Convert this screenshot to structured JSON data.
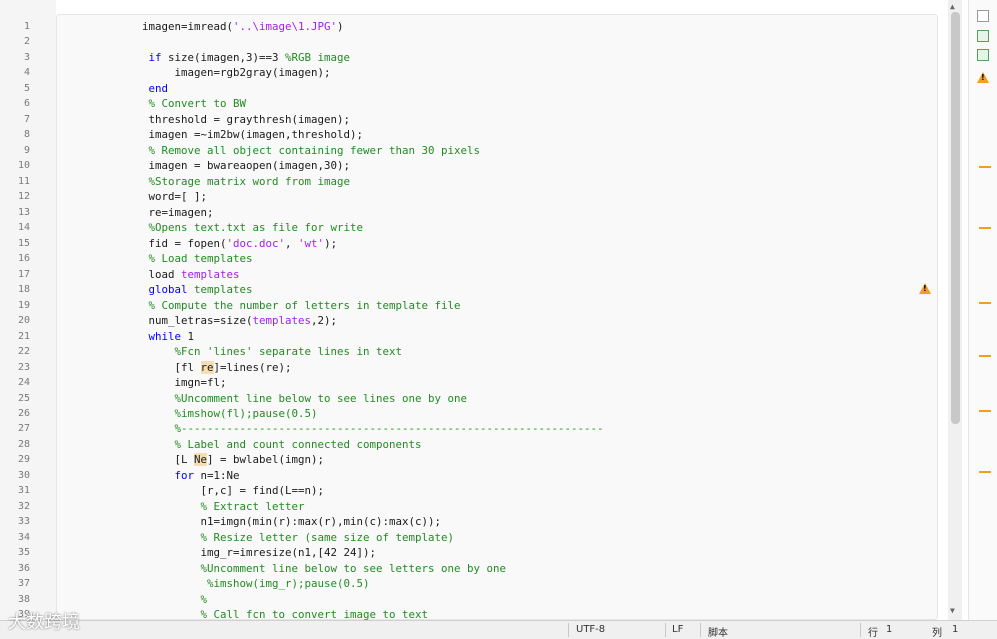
{
  "gutter": {
    "line_numbers": [
      "1",
      "2",
      "3",
      "4",
      "5",
      "6",
      "7",
      "8",
      "9",
      "10",
      "11",
      "12",
      "13",
      "14",
      "15",
      "16",
      "17",
      "18",
      "19",
      "20",
      "21",
      "22",
      "23",
      "24",
      "25",
      "26",
      "27",
      "28",
      "29",
      "30",
      "31",
      "32",
      "33",
      "34",
      "35",
      "36",
      "37",
      "38",
      "39"
    ]
  },
  "code_lines": [
    {
      "indent": 14,
      "parts": [
        {
          "t": "imagen=imread("
        },
        {
          "t": "'..\\image\\1.JPG'",
          "c": "st"
        },
        {
          "t": ")"
        }
      ]
    },
    {
      "indent": 14,
      "parts": []
    },
    {
      "indent": 15,
      "parts": [
        {
          "t": "if",
          "c": "kw"
        },
        {
          "t": " size(imagen,3)==3 "
        },
        {
          "t": "%RGB image",
          "c": "cm"
        }
      ]
    },
    {
      "indent": 19,
      "parts": [
        {
          "t": "imagen=rgb2gray(imagen);"
        }
      ]
    },
    {
      "indent": 15,
      "parts": [
        {
          "t": "end",
          "c": "kw"
        }
      ]
    },
    {
      "indent": 15,
      "parts": [
        {
          "t": "% Convert to BW",
          "c": "cm"
        }
      ]
    },
    {
      "indent": 15,
      "parts": [
        {
          "t": "threshold = graythresh(imagen);"
        }
      ]
    },
    {
      "indent": 15,
      "parts": [
        {
          "t": "imagen =~im2bw(imagen,threshold);"
        }
      ]
    },
    {
      "indent": 15,
      "parts": [
        {
          "t": "% Remove all object containing fewer than 30 pixels",
          "c": "cm"
        }
      ]
    },
    {
      "indent": 15,
      "parts": [
        {
          "t": "imagen = bwareaopen(imagen,30);"
        }
      ]
    },
    {
      "indent": 15,
      "parts": [
        {
          "t": "%Storage matrix word from image",
          "c": "cm"
        }
      ]
    },
    {
      "indent": 15,
      "parts": [
        {
          "t": "word=[ ];"
        }
      ]
    },
    {
      "indent": 15,
      "parts": [
        {
          "t": "re=imagen;"
        }
      ]
    },
    {
      "indent": 15,
      "parts": [
        {
          "t": "%Opens text.txt as file for write",
          "c": "cm"
        }
      ]
    },
    {
      "indent": 15,
      "parts": [
        {
          "t": "fid = fopen("
        },
        {
          "t": "'doc.doc'",
          "c": "st"
        },
        {
          "t": ", "
        },
        {
          "t": "'wt'",
          "c": "st"
        },
        {
          "t": ");"
        }
      ]
    },
    {
      "indent": 15,
      "parts": [
        {
          "t": "% Load templates",
          "c": "cm"
        }
      ]
    },
    {
      "indent": 15,
      "parts": [
        {
          "t": "load "
        },
        {
          "t": "templates",
          "c": "st"
        }
      ]
    },
    {
      "indent": 15,
      "parts": [
        {
          "t": "global",
          "c": "kw"
        },
        {
          "t": " templates",
          "c": "cm"
        }
      ]
    },
    {
      "indent": 15,
      "parts": [
        {
          "t": "% Compute the number of letters in template file",
          "c": "cm"
        }
      ]
    },
    {
      "indent": 15,
      "parts": [
        {
          "t": "num_letras=size("
        },
        {
          "t": "templates",
          "c": "st"
        },
        {
          "t": ",2);"
        }
      ]
    },
    {
      "indent": 15,
      "parts": [
        {
          "t": "while",
          "c": "kw"
        },
        {
          "t": " 1"
        }
      ]
    },
    {
      "indent": 19,
      "parts": [
        {
          "t": "%Fcn 'lines' separate lines in text",
          "c": "cm"
        }
      ]
    },
    {
      "indent": 19,
      "parts": [
        {
          "t": "[fl "
        },
        {
          "t": "re",
          "c": "hl"
        },
        {
          "t": "]=lines(re);"
        }
      ]
    },
    {
      "indent": 19,
      "parts": [
        {
          "t": "imgn=fl;"
        }
      ]
    },
    {
      "indent": 19,
      "parts": [
        {
          "t": "%Uncomment line below to see lines one by one",
          "c": "cm"
        }
      ]
    },
    {
      "indent": 19,
      "parts": [
        {
          "t": "%imshow(fl);pause(0.5)",
          "c": "cm"
        }
      ]
    },
    {
      "indent": 19,
      "parts": [
        {
          "t": "%-----------------------------------------------------------------",
          "c": "cm"
        }
      ]
    },
    {
      "indent": 19,
      "parts": [
        {
          "t": "% Label and count connected components",
          "c": "cm"
        }
      ]
    },
    {
      "indent": 19,
      "parts": [
        {
          "t": "[L "
        },
        {
          "t": "Ne",
          "c": "hl"
        },
        {
          "t": "] = bwlabel(imgn);"
        }
      ]
    },
    {
      "indent": 19,
      "parts": [
        {
          "t": "for",
          "c": "kw"
        },
        {
          "t": " n=1:Ne"
        }
      ]
    },
    {
      "indent": 23,
      "parts": [
        {
          "t": "[r,c] = find(L==n);"
        }
      ]
    },
    {
      "indent": 23,
      "parts": [
        {
          "t": "% Extract letter",
          "c": "cm"
        }
      ]
    },
    {
      "indent": 23,
      "parts": [
        {
          "t": "n1=imgn(min(r):max(r),min(c):max(c));"
        }
      ]
    },
    {
      "indent": 23,
      "parts": [
        {
          "t": "% Resize letter (same size of template)",
          "c": "cm"
        }
      ]
    },
    {
      "indent": 23,
      "parts": [
        {
          "t": "img_r=imresize(n1,[42 24]);"
        }
      ]
    },
    {
      "indent": 23,
      "parts": [
        {
          "t": "%Uncomment line below to see letters one by one",
          "c": "cm"
        }
      ]
    },
    {
      "indent": 24,
      "parts": [
        {
          "t": "%imshow(img_r);pause(0.5)",
          "c": "cm"
        }
      ]
    },
    {
      "indent": 23,
      "parts": [
        {
          "t": "%",
          "c": "cm"
        }
      ]
    },
    {
      "indent": 23,
      "parts": [
        {
          "t": "% Call fcn to convert image to text",
          "c": "cm"
        }
      ]
    }
  ],
  "status": {
    "encoding": "UTF-8",
    "line_ending": "LF",
    "mode": "脚本",
    "row_label": "行",
    "row_value": "1",
    "col_label": "列",
    "col_value": "1"
  },
  "watermark": "大数跨境",
  "icons": {
    "right1": "file-compare-icon",
    "right2": "file-plus-icon",
    "right3": "file-export-icon",
    "right4": "warning-icon",
    "inline_warning": "warning-icon"
  },
  "colors": {
    "keyword": "#0000ff",
    "string": "#a020f0",
    "comment": "#228b22",
    "highlight": "#f5deb3",
    "marker": "#f0a020"
  }
}
